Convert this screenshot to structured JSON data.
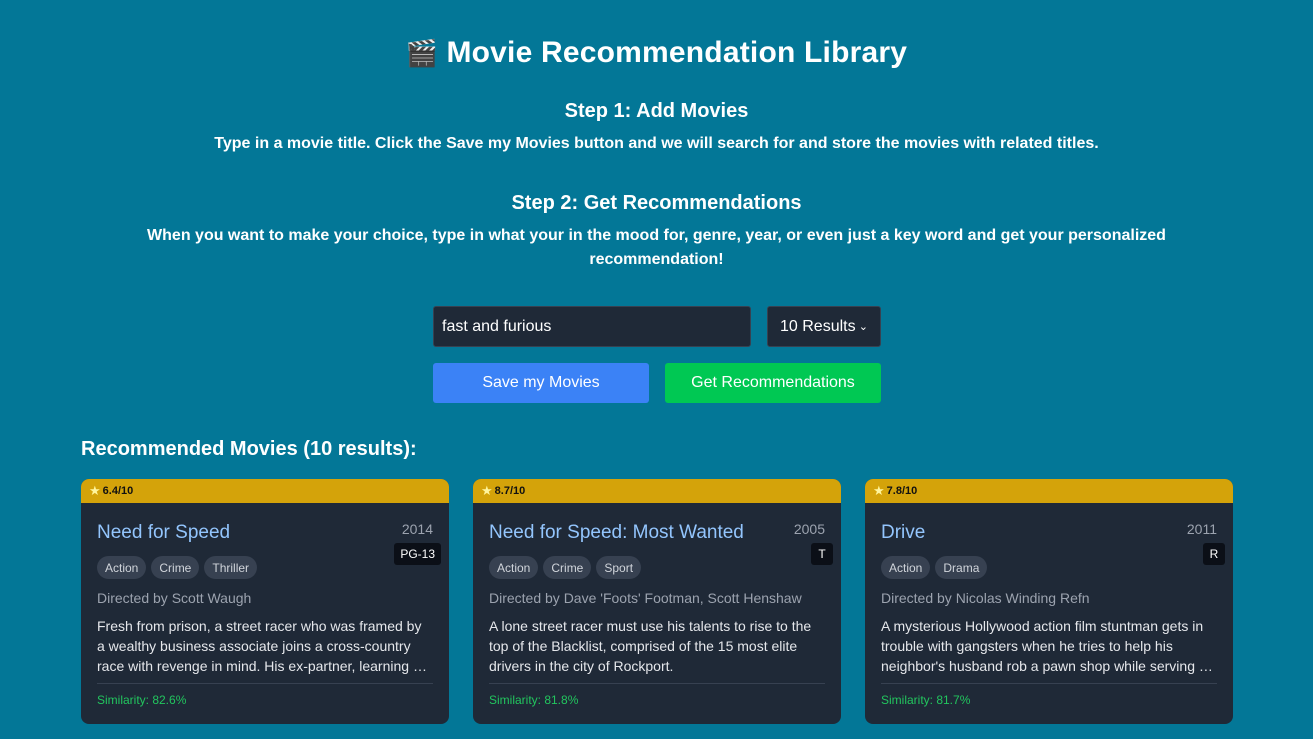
{
  "header": {
    "icon": "clapperboard-icon",
    "title": "Movie Recommendation Library"
  },
  "steps": [
    {
      "heading": "Step 1: Add Movies",
      "text": "Type in a movie title. Click the Save my Movies button and we will search for and store the movies with related titles."
    },
    {
      "heading": "Step 2: Get Recommendations",
      "text": "When you want to make your choice, type in what your in the mood for, genre, year, or even just a key word and get your personalized recommendation!"
    }
  ],
  "search": {
    "value": "fast and furious",
    "placeholder": ""
  },
  "results_select": {
    "selected": "10 Results"
  },
  "buttons": {
    "save": "Save my Movies",
    "recommend": "Get Recommendations"
  },
  "results": {
    "heading": "Recommended Movies (10 results):",
    "movies": [
      {
        "rating": "6.4/10",
        "title": "Need for Speed",
        "year": "2014",
        "certification": "PG-13",
        "genres": [
          "Action",
          "Crime",
          "Thriller"
        ],
        "director": "Directed by Scott Waugh",
        "overview": "Fresh from prison, a street racer who was framed by a wealthy business associate joins a cross-country race with revenge in mind. His ex-partner, learning of the plan, places a massive bounty on his head.",
        "similarity": "Similarity: 82.6%"
      },
      {
        "rating": "8.7/10",
        "title": "Need for Speed: Most Wanted",
        "year": "2005",
        "certification": "T",
        "genres": [
          "Action",
          "Crime",
          "Sport"
        ],
        "director": "Directed by Dave 'Foots' Footman, Scott Henshaw",
        "overview": "A lone street racer must use his talents to rise to the top of the Blacklist, comprised of the 15 most elite drivers in the city of Rockport.",
        "similarity": "Similarity: 81.8%"
      },
      {
        "rating": "7.8/10",
        "title": "Drive",
        "year": "2011",
        "certification": "R",
        "genres": [
          "Action",
          "Drama"
        ],
        "director": "Directed by Nicolas Winding Refn",
        "overview": "A mysterious Hollywood action film stuntman gets in trouble with gangsters when he tries to help his neighbor's husband rob a pawn shop while serving his time.",
        "similarity": "Similarity: 81.7%"
      }
    ]
  },
  "colors": {
    "background": "#037797",
    "card": "#1f2937",
    "rating_bar": "#d4a30a",
    "save_button": "#3b82f6",
    "recommend_button": "#00c853",
    "title_link": "#93c5fd",
    "similarity": "#22c55e"
  }
}
